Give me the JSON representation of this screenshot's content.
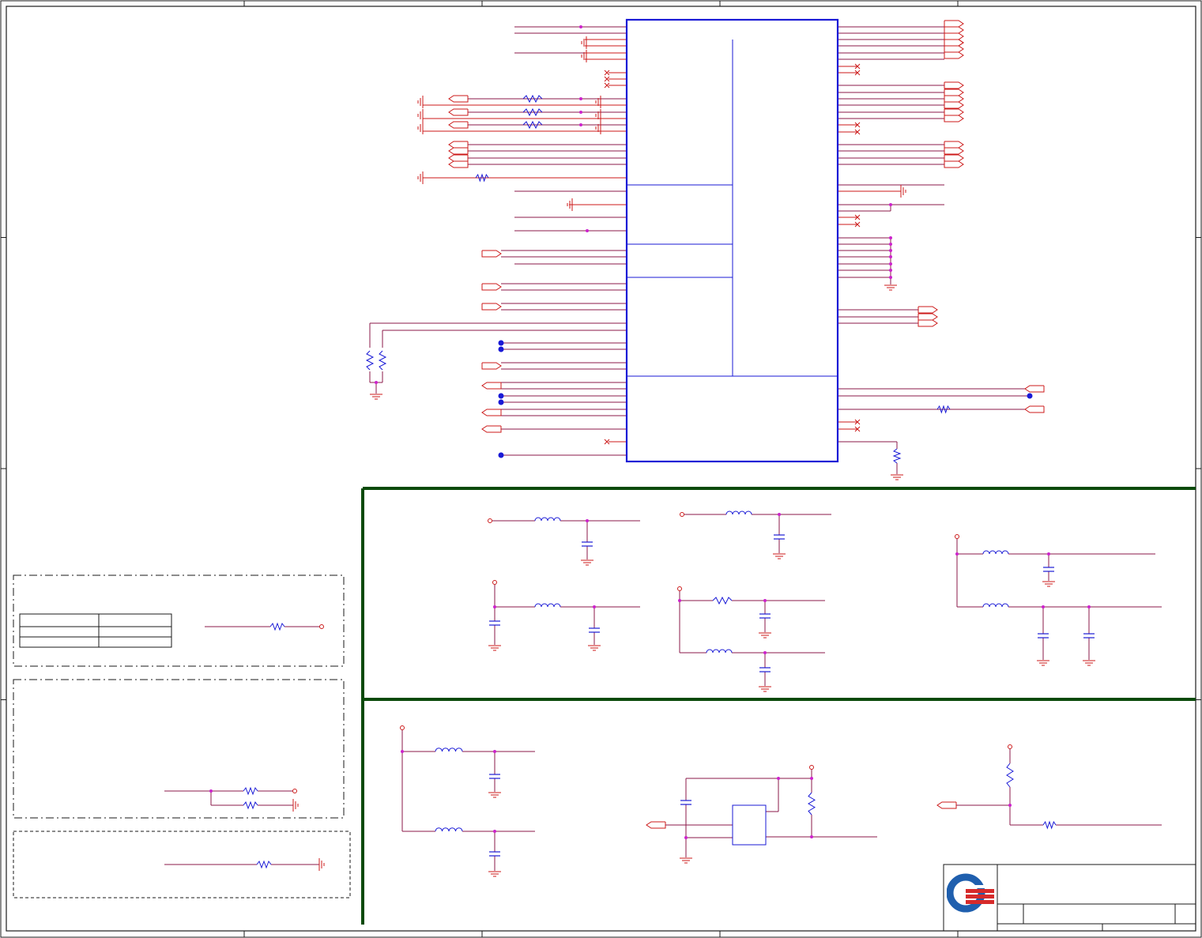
{
  "colors": {
    "wire": "#8b1a4a",
    "net": "#cc1a1a",
    "component": "#1a1ad6",
    "junction": "#cc22cc",
    "frame": "#1a1a1a",
    "section_divider": "#0a4a0a",
    "logo_blue": "#1f5fae",
    "logo_red": "#d62b2b"
  },
  "border_zones": {
    "columns": 5,
    "rows": 4
  },
  "chip": {
    "left_pin_count": 32,
    "right_pin_count": 39,
    "internal_sections": 5
  },
  "logo": {
    "icon": "company-logo-icon"
  }
}
